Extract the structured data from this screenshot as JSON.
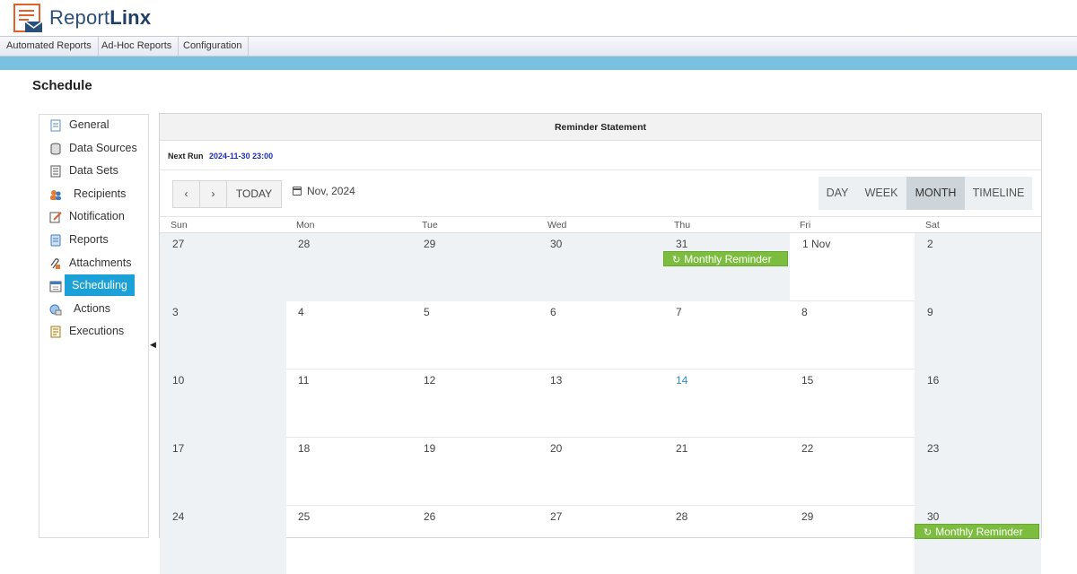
{
  "header": {
    "brand_prefix": "Report",
    "brand_suffix": "Linx",
    "menu": [
      "Automated Reports",
      "Ad-Hoc Reports",
      "Configuration"
    ]
  },
  "page": {
    "title": "Schedule"
  },
  "sidebar": {
    "items": [
      {
        "label": "General",
        "icon": "general-icon"
      },
      {
        "label": "Data Sources",
        "icon": "database-icon"
      },
      {
        "label": "Data Sets",
        "icon": "dataset-icon"
      },
      {
        "label": "Recipients",
        "icon": "recipients-icon"
      },
      {
        "label": "Notification",
        "icon": "notification-icon"
      },
      {
        "label": "Reports",
        "icon": "reports-icon"
      },
      {
        "label": "Attachments",
        "icon": "attachments-icon"
      },
      {
        "label": "Scheduling",
        "icon": "scheduling-icon",
        "active": true
      },
      {
        "label": "Actions",
        "icon": "actions-icon"
      },
      {
        "label": "Executions",
        "icon": "executions-icon"
      }
    ]
  },
  "panel": {
    "title": "Reminder Statement",
    "next_run_label": "Next Run",
    "next_run_value": "2024-11-30 23:00"
  },
  "toolbar": {
    "prev": "‹",
    "next": "›",
    "today": "TODAY",
    "current": "Nov, 2024",
    "views": [
      "DAY",
      "WEEK",
      "MONTH",
      "TIMELINE"
    ],
    "active_view": "MONTH"
  },
  "calendar": {
    "weekdays": [
      "Sun",
      "Mon",
      "Tue",
      "Wed",
      "Thu",
      "Fri",
      "Sat"
    ],
    "weeks": [
      [
        "27",
        "28",
        "29",
        "30",
        "31",
        "1 Nov",
        "2"
      ],
      [
        "3",
        "4",
        "5",
        "6",
        "7",
        "8",
        "9"
      ],
      [
        "10",
        "11",
        "12",
        "13",
        "14",
        "15",
        "16"
      ],
      [
        "17",
        "18",
        "19",
        "20",
        "21",
        "22",
        "23"
      ],
      [
        "24",
        "25",
        "26",
        "27",
        "28",
        "29",
        "30"
      ]
    ],
    "today": "14",
    "events": [
      {
        "label": "Monthly Reminder"
      },
      {
        "label": "Monthly Reminder"
      }
    ]
  },
  "colors": {
    "accent": "#1ba1d8",
    "band": "#79c1de",
    "event": "#7cbd3f",
    "today_text": "#2d8fd0"
  }
}
